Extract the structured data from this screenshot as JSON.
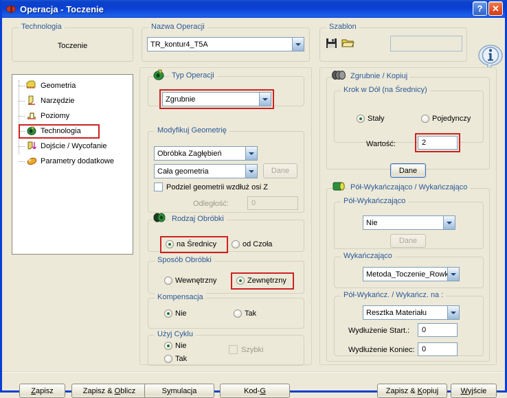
{
  "window": {
    "title": "Operacja - Toczenie",
    "app_icon": "ladybug-icon",
    "help_label": "?",
    "close_label": "✕",
    "accent_titlebar": "#0a3fd4",
    "face_color": "#ece9d8",
    "highlight_color": "#cc2222"
  },
  "technologia_group": {
    "title": "Technologia",
    "value": "Toczenie"
  },
  "tree": {
    "items": [
      {
        "label": "Geometria",
        "icon": "geometry-icon",
        "selected": false
      },
      {
        "label": "Narzędzie",
        "icon": "tool-icon",
        "selected": false
      },
      {
        "label": "Poziomy",
        "icon": "levels-icon",
        "selected": false
      },
      {
        "label": "Technologia",
        "icon": "technology-icon",
        "selected": true
      },
      {
        "label": "Dojście / Wycofanie",
        "icon": "approach-retract-icon",
        "selected": false
      },
      {
        "label": "Parametry dodatkowe",
        "icon": "additional-parameters-icon",
        "selected": false
      }
    ]
  },
  "nazwa_operacji": {
    "title": "Nazwa Operacji",
    "value": "TR_kontur4_T5A"
  },
  "szablon": {
    "title": "Szablon",
    "save_icon": "save-floppy-icon",
    "open_icon": "open-folder-icon",
    "value": "",
    "info_icon": "info-icon"
  },
  "typ_operacji": {
    "title": "Typ Operacji",
    "icon": "operation-type-icon",
    "value": "Zgrubnie",
    "highlighted": true
  },
  "modyfikuj_geometrie": {
    "title": "Modyfikuj Geometrię",
    "combo1_value": "Obróbka Zagłębień",
    "combo2_value": "Cała geometria",
    "dane_label": "Dane",
    "checkbox_label": "Podziel geometrii wzdłuż osi Z",
    "checkbox_checked": false,
    "odleglosc_label": "Odległość:",
    "odleglosc_value": "0"
  },
  "rodzaj_obrobki": {
    "title": "Rodzaj Obróbki",
    "icon": "machining-kind-icon",
    "options": [
      {
        "label": "na Średnicy",
        "selected": true,
        "highlighted": true
      },
      {
        "label": "od Czoła",
        "selected": false,
        "highlighted": false
      }
    ]
  },
  "sposob_obrobki": {
    "title": "Sposób Obróbki",
    "options": [
      {
        "label": "Wewnętrzny",
        "selected": false,
        "highlighted": false
      },
      {
        "label": "Zewnętrzny",
        "selected": true,
        "highlighted": true
      }
    ]
  },
  "kompensacja": {
    "title": "Kompensacja",
    "options": [
      {
        "label": "Nie",
        "selected": true
      },
      {
        "label": "Tak",
        "selected": false
      }
    ]
  },
  "uzyj_cyklu": {
    "title": "Użyj Cyklu",
    "options": [
      {
        "label": "Nie",
        "selected": true
      },
      {
        "label": "Tak",
        "selected": false
      }
    ],
    "szybki_label": "Szybki",
    "szybki_checked": false,
    "szybki_disabled": true
  },
  "zgrubnie_kopiuj": {
    "title": "Zgrubnie / Kopiuj",
    "icon": "roughing-icon",
    "krok_title": "Krok w Dół (na Średnicy)",
    "options": [
      {
        "label": "Stały",
        "selected": true
      },
      {
        "label": "Pojedynczy",
        "selected": false
      }
    ],
    "wartosc_label": "Wartość:",
    "wartosc_value": "2",
    "wartosc_highlighted": true,
    "dane_label": "Dane"
  },
  "pol_wykanczajaco": {
    "title": "Pół-Wykańczająco / Wykańczająco",
    "icon": "finishing-icon",
    "sub1_title": "Pół-Wykańczająco",
    "sub1_value": "Nie",
    "sub1_dane_label": "Dane",
    "sub2_title": "Wykańczająco",
    "sub2_value": "Metoda_Toczenie_Rowkow",
    "sub3_title": "Pół-Wykańcz. / Wykańcz. na :",
    "sub3_value": "Resztka Materiału",
    "start_label": "Wydłużenie Start.:",
    "start_value": "0",
    "koniec_label": "Wydłużenie Koniec:",
    "koniec_value": "0"
  },
  "footer": {
    "buttons": [
      {
        "name": "zapisz",
        "pre": "",
        "accel": "Z",
        "post": "apisz"
      },
      {
        "name": "zapisz-oblicz",
        "pre": "Zapisz & ",
        "accel": "O",
        "post": "blicz"
      },
      {
        "name": "symulacja",
        "pre": "S",
        "accel": "y",
        "post": "mulacja"
      },
      {
        "name": "kod-g",
        "pre": "Kod-",
        "accel": "G",
        "post": ""
      },
      {
        "name": "zapisz-kopiuj",
        "pre": "Zapisz & ",
        "accel": "K",
        "post": "opiuj"
      },
      {
        "name": "wyjscie",
        "pre": "",
        "accel": "W",
        "post": "yjście"
      }
    ]
  }
}
